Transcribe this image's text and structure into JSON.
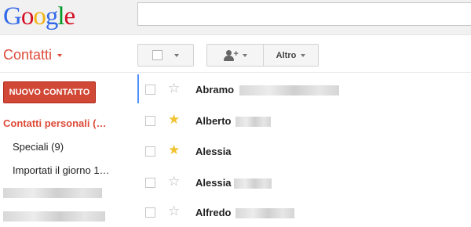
{
  "header": {
    "logo_letters": [
      "G",
      "o",
      "o",
      "g",
      "l",
      "e"
    ],
    "app_title": "Contatti",
    "search_value": ""
  },
  "toolbar": {
    "more_label": "Altro"
  },
  "sidebar": {
    "new_contact_label": "NUOVO CONTATTO",
    "personal_contacts_label": "Contatti personali (…",
    "special_label": "Speciali (9)",
    "imported_label": "Importati il giorno 1…"
  },
  "contacts": [
    {
      "name": "Abramo",
      "starred": false
    },
    {
      "name": "Alberto",
      "starred": true
    },
    {
      "name": "Alessia",
      "starred": true
    },
    {
      "name": "Alessia",
      "starred": false
    },
    {
      "name": "Alfredo",
      "starred": false
    }
  ],
  "colors": {
    "accent_red": "#dd4b39",
    "button_red": "#d14836",
    "star_on": "#f2c231",
    "selection_blue": "#4d90fe"
  },
  "icons": {
    "star": "star-icon",
    "add_contact": "add-person-icon",
    "checkbox": "checkbox-icon"
  }
}
